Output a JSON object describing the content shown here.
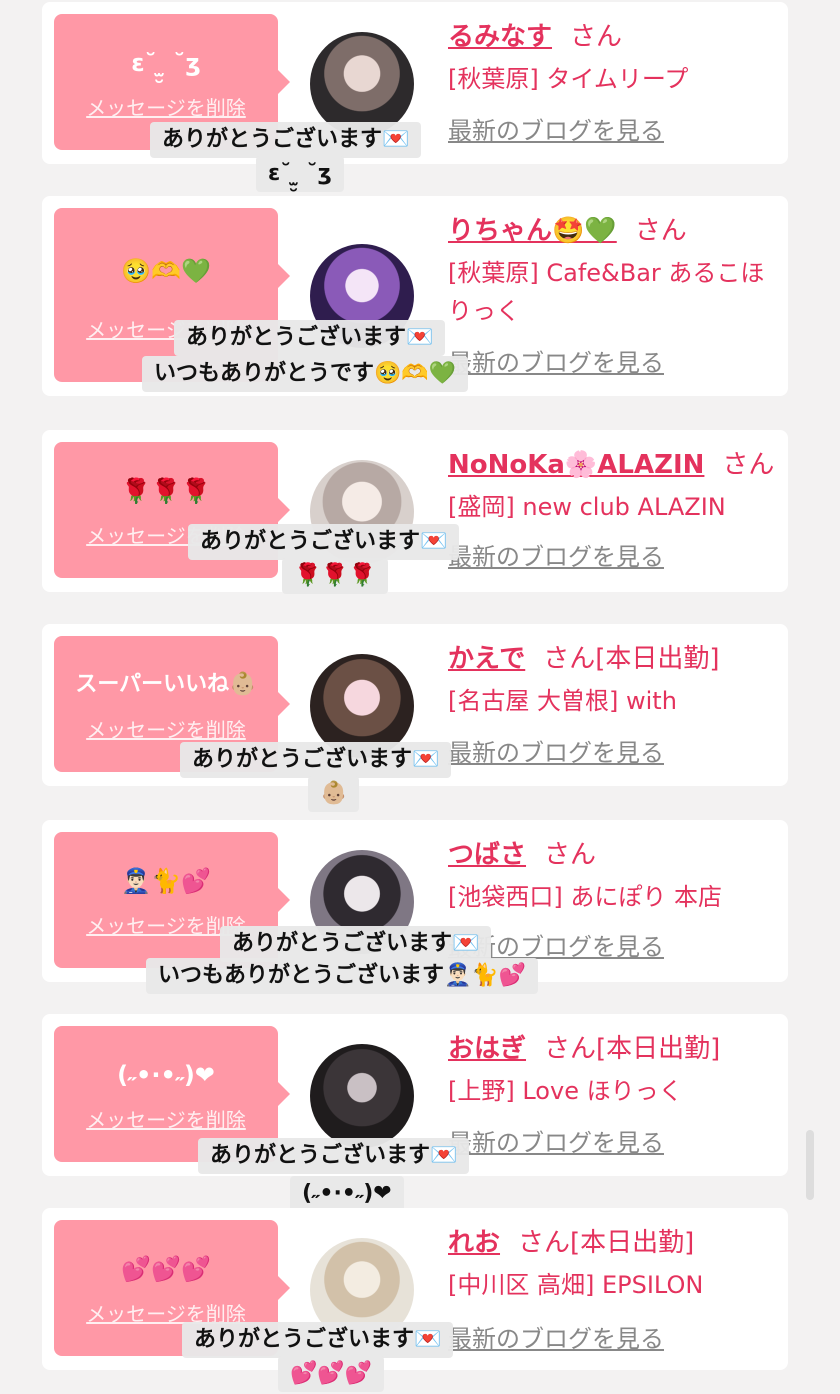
{
  "messages": [
    {
      "bubble_text": "ɛ˘ ̫̮ ˘ʒ",
      "delete_label": "メッセージを削除",
      "name": "るみなす",
      "honorific": "さん",
      "status": "",
      "shop": "[秋葉原] タイムリープ",
      "blog_link": "最新のブログを見る",
      "caption_line1": "ありがとうございます💌",
      "caption_line2": "ɛ˘ ̫̮ ˘ʒ"
    },
    {
      "bubble_text": "🥹🫶💚",
      "delete_label": "メッセージを削除",
      "name": "りちゃん🤩💚",
      "honorific": "さん",
      "status": "",
      "shop": "[秋葉原] Cafe&Bar あるこほりっく",
      "blog_link": "最新のブログを見る",
      "caption_line1": "ありがとうございます💌",
      "caption_line2": "いつもありがとうです🥹🫶💚"
    },
    {
      "bubble_text": "🌹🌹🌹",
      "delete_label": "メッセージを削除",
      "name": "NoNoKa🌸ALAZIN",
      "honorific": "さん",
      "status": "",
      "shop": "[盛岡] new club ALAZIN",
      "blog_link": "最新のブログを見る",
      "caption_line1": "ありがとうございます💌",
      "caption_line2": "🌹🌹🌹"
    },
    {
      "bubble_text": "スーパーいいね👶🏼",
      "delete_label": "メッセージを削除",
      "name": "かえで",
      "honorific": "さん",
      "status": "[本日出勤]",
      "shop": "[名古屋 大曽根] with",
      "blog_link": "最新のブログを見る",
      "caption_line1": "ありがとうございます💌",
      "caption_line2": "👶🏼"
    },
    {
      "bubble_text": "👮🏻‍♂️🐈💕",
      "delete_label": "メッセージを削除",
      "name": "つばさ",
      "honorific": "さん",
      "status": "",
      "shop": "[池袋西口] あにぽり 本店",
      "blog_link": "最新のブログを見る",
      "caption_line1": "ありがとうございます💌",
      "caption_line2": "いつもありがとうございます👮🏻‍♂️🐈💕"
    },
    {
      "bubble_text": "(˶•·•˶)❤",
      "delete_label": "メッセージを削除",
      "name": "おはぎ",
      "honorific": "さん",
      "status": "[本日出勤]",
      "shop": "[上野] Love ほりっく",
      "blog_link": "最新のブログを見る",
      "caption_line1": "ありがとうございます💌",
      "caption_line2": "(˶•·•˶)❤"
    },
    {
      "bubble_text": "💕💕💕",
      "delete_label": "メッセージを削除",
      "name": "れお",
      "honorific": "さん",
      "status": "[本日出勤]",
      "shop": "[中川区 高畑] EPSILON",
      "blog_link": "最新のブログを見る",
      "caption_line1": "ありがとうございます💌",
      "caption_line2": "💕💕💕"
    }
  ],
  "colors": {
    "accent": "#e4325d",
    "bubble": "#ff98a6",
    "card": "#ffffff",
    "background": "#f3f2f2"
  },
  "icons": [
    "avatar-photo",
    "speech-bubble-tail"
  ]
}
